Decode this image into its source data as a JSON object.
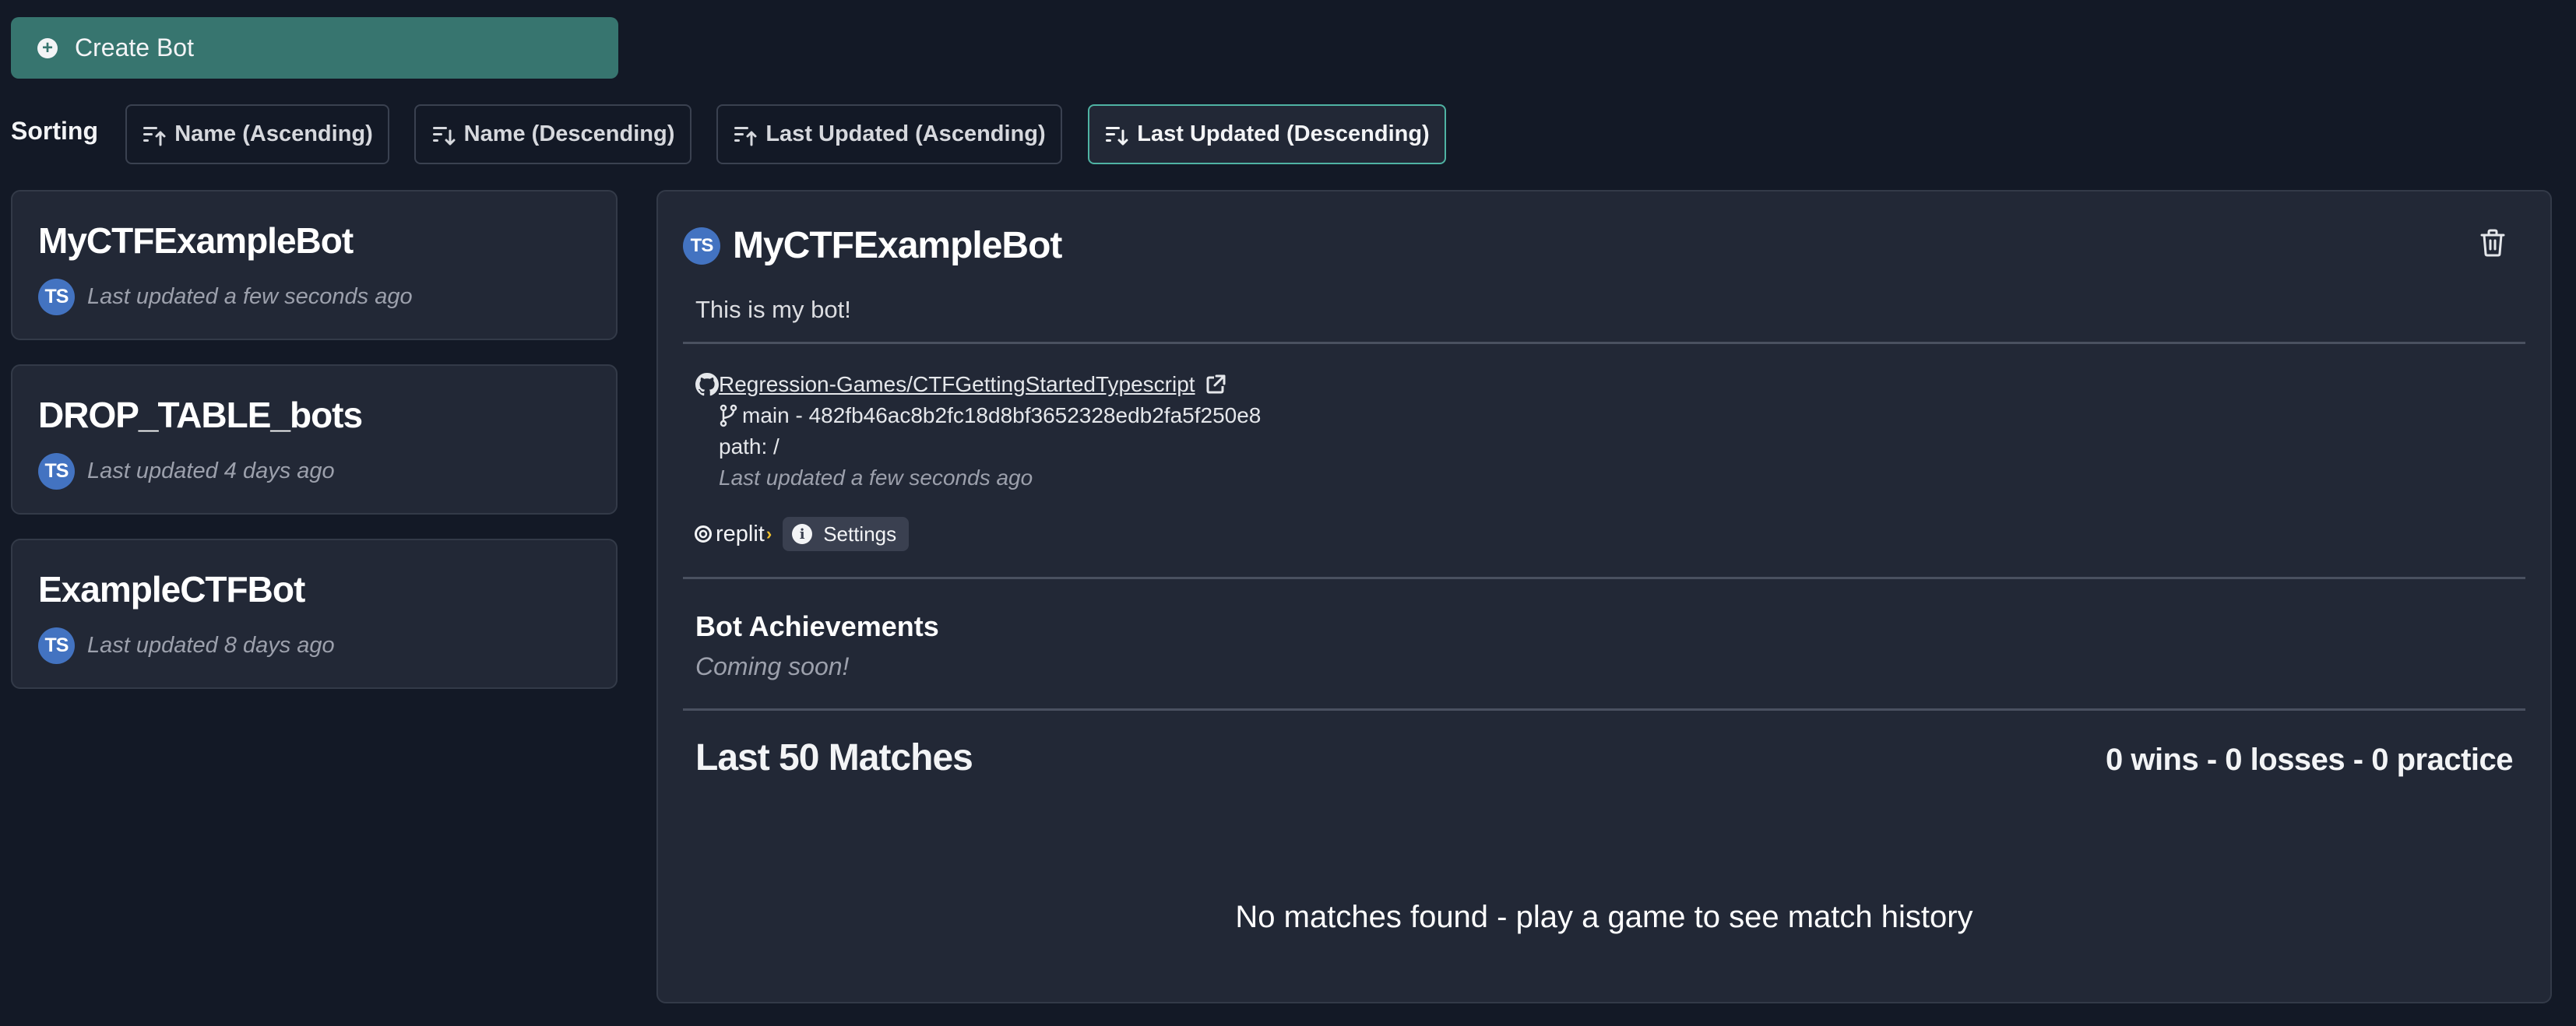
{
  "toolbar": {
    "create_bot_label": "Create Bot",
    "create_bot_icon": "plus-circle-icon"
  },
  "sorting": {
    "label": "Sorting",
    "options": [
      {
        "label": "Name (Ascending)",
        "icon": "sort-ascending-icon",
        "active": false
      },
      {
        "label": "Name (Descending)",
        "icon": "sort-descending-icon",
        "active": false
      },
      {
        "label": "Last Updated (Ascending)",
        "icon": "sort-ascending-icon",
        "active": false
      },
      {
        "label": "Last Updated (Descending)",
        "icon": "sort-descending-icon",
        "active": true
      }
    ]
  },
  "bots": [
    {
      "name": "MyCTFExampleBot",
      "language_badge": "TS",
      "updated": "Last updated a few seconds ago"
    },
    {
      "name": "DROP_TABLE_bots",
      "language_badge": "TS",
      "updated": "Last updated 4 days ago"
    },
    {
      "name": "ExampleCTFBot",
      "language_badge": "TS",
      "updated": "Last updated 8 days ago"
    }
  ],
  "detail": {
    "language_badge": "TS",
    "title": "MyCTFExampleBot",
    "description": "This is my bot!",
    "repo": {
      "name": "Regression-Games/CTFGettingStartedTypescript",
      "branch_line": "main - 482fb46ac8b2fc18d8bf3652328edb2fa5f250e8",
      "path_line": "path: /",
      "updated": "Last updated a few seconds ago"
    },
    "replit_label": "replit",
    "settings_label": "Settings",
    "achievements": {
      "title": "Bot Achievements",
      "subtitle": "Coming soon!"
    },
    "matches": {
      "title": "Last 50 Matches",
      "stats": "0 wins - 0 losses - 0 practice",
      "wins": 0,
      "losses": 0,
      "practice": 0,
      "empty_message": "No matches found - play a game to see match history"
    }
  },
  "colors": {
    "background": "#131926",
    "panel": "#222836",
    "accent": "#37756f",
    "active_border": "#4fb3a3",
    "ts_badge": "#4373c1",
    "replit_chevron": "#f2c12e"
  }
}
